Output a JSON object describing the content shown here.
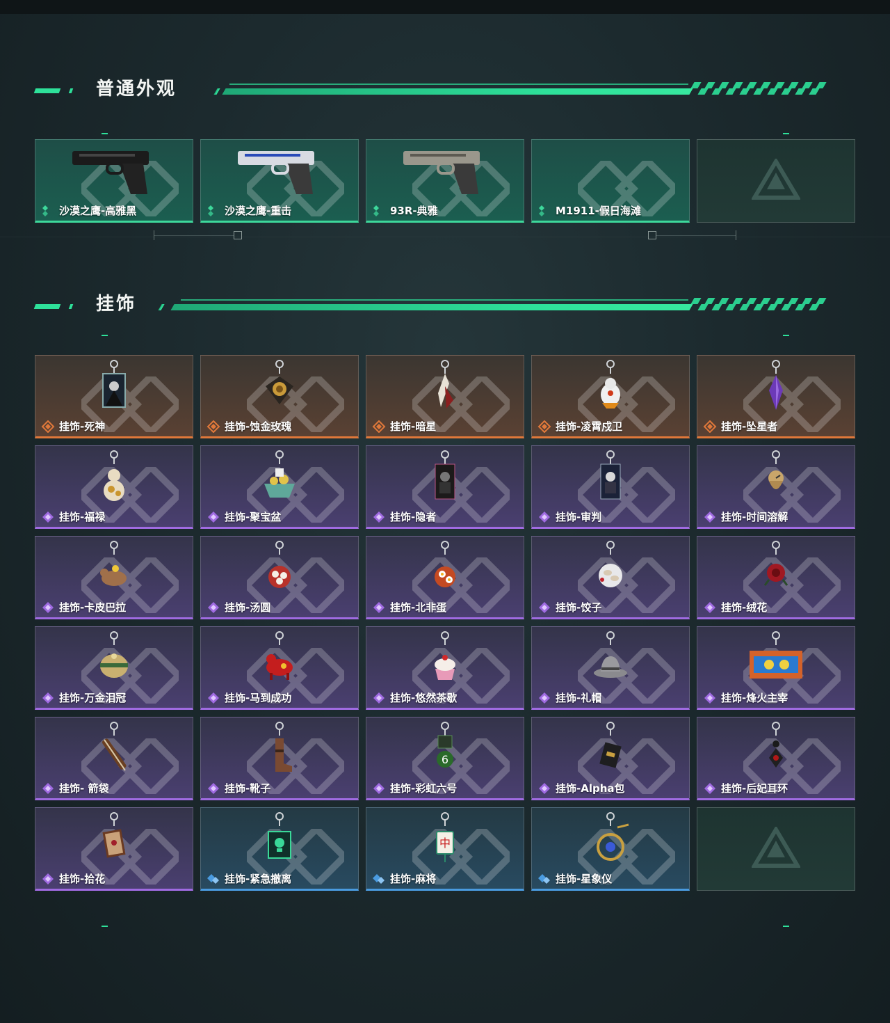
{
  "sections": {
    "skins": {
      "title": "普通外观"
    },
    "charms": {
      "title": "挂饰"
    }
  },
  "colors": {
    "accent": "#2ee19a",
    "rarity_green": "#3dd89b",
    "rarity_orange": "#e0783a",
    "rarity_purple": "#a06be2",
    "rarity_blue": "#4a9be0"
  },
  "skins": [
    {
      "name": "沙漠之鹰-高雅黑",
      "rarity": "green",
      "icon": "pistol-black-icon"
    },
    {
      "name": "沙漠之鹰-重击",
      "rarity": "green",
      "icon": "pistol-white-blue-icon"
    },
    {
      "name": "93R-典雅",
      "rarity": "green",
      "icon": "pistol-camo-icon"
    },
    {
      "name": "M1911-假日海滩",
      "rarity": "green",
      "icon": ""
    },
    {
      "name": "",
      "rarity": "empty",
      "icon": "logo-icon"
    }
  ],
  "charms": [
    {
      "name": "挂饰-死神",
      "rarity": "orange",
      "icon": "reaper-card-charm-icon"
    },
    {
      "name": "挂饰-蚀金玫瑰",
      "rarity": "orange",
      "icon": "gold-rose-charm-icon"
    },
    {
      "name": "挂饰-暗星",
      "rarity": "orange",
      "icon": "dark-star-charm-icon"
    },
    {
      "name": "挂饰-凌霄戍卫",
      "rarity": "orange",
      "icon": "guardian-charm-icon"
    },
    {
      "name": "挂饰-坠星者",
      "rarity": "orange",
      "icon": "crystal-charm-icon"
    },
    {
      "name": "挂饰-福禄",
      "rarity": "purple",
      "icon": "gourd-charm-icon"
    },
    {
      "name": "挂饰-聚宝盆",
      "rarity": "purple",
      "icon": "treasure-bowl-charm-icon"
    },
    {
      "name": "挂饰-隐者",
      "rarity": "purple",
      "icon": "hermit-card-charm-icon"
    },
    {
      "name": "挂饰-审判",
      "rarity": "purple",
      "icon": "judgement-card-charm-icon"
    },
    {
      "name": "挂饰-时间溶解",
      "rarity": "purple",
      "icon": "melting-clock-charm-icon"
    },
    {
      "name": "挂饰-卡皮巴拉",
      "rarity": "purple",
      "icon": "capybara-charm-icon"
    },
    {
      "name": "挂饰-汤圆",
      "rarity": "purple",
      "icon": "tangyuan-charm-icon"
    },
    {
      "name": "挂饰-北非蛋",
      "rarity": "purple",
      "icon": "shakshuka-charm-icon"
    },
    {
      "name": "挂饰-饺子",
      "rarity": "purple",
      "icon": "dumpling-charm-icon"
    },
    {
      "name": "挂饰-绒花",
      "rarity": "purple",
      "icon": "velvet-flower-charm-icon"
    },
    {
      "name": "挂饰-万金泪冠",
      "rarity": "purple",
      "icon": "crown-charm-icon"
    },
    {
      "name": "挂饰-马到成功",
      "rarity": "purple",
      "icon": "red-horse-charm-icon"
    },
    {
      "name": "挂饰-悠然茶歇",
      "rarity": "purple",
      "icon": "cupcake-charm-icon"
    },
    {
      "name": "挂饰-礼帽",
      "rarity": "purple",
      "icon": "fedora-charm-icon"
    },
    {
      "name": "挂饰-烽火主宰",
      "rarity": "purple",
      "icon": "poster-charm-icon"
    },
    {
      "name": "挂饰- 箭袋",
      "rarity": "purple",
      "icon": "quiver-charm-icon"
    },
    {
      "name": "挂饰-靴子",
      "rarity": "purple",
      "icon": "boot-charm-icon"
    },
    {
      "name": "挂饰-彩虹六号",
      "rarity": "purple",
      "icon": "rainbow-six-charm-icon"
    },
    {
      "name": "挂饰-Alpha包",
      "rarity": "purple",
      "icon": "alpha-bag-charm-icon"
    },
    {
      "name": "挂饰-后妃耳环",
      "rarity": "purple",
      "icon": "earring-charm-icon"
    },
    {
      "name": "挂饰-拾花",
      "rarity": "purple",
      "icon": "flower-frame-charm-icon"
    },
    {
      "name": "挂饰-紧急撤离",
      "rarity": "blue",
      "icon": "skull-box-charm-icon"
    },
    {
      "name": "挂饰-麻将",
      "rarity": "blue",
      "icon": "mahjong-charm-icon"
    },
    {
      "name": "挂饰-星象仪",
      "rarity": "blue",
      "icon": "orrery-charm-icon"
    },
    {
      "name": "",
      "rarity": "empty",
      "icon": "logo-icon"
    }
  ]
}
